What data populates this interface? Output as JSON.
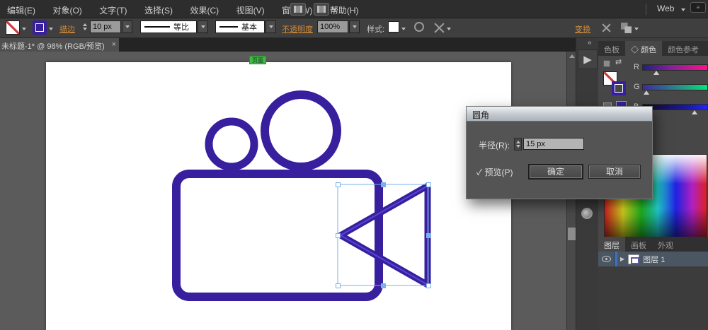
{
  "colors": {
    "artwork_purple": "#371f9e",
    "artwork_highlight": "#5546d8",
    "selection_blue": "#7ab1e8",
    "smart_guide_green": "#44b749",
    "link_orange": "#cf8a3a"
  },
  "icons": {
    "dropdown": "▾",
    "close": "×",
    "collapse": "«",
    "play": "▶",
    "expand": "▶",
    "check": "✓",
    "swap": "⇄",
    "char_panel": "A|",
    "paragraph_panel": "¶",
    "diamond": "◇"
  },
  "menu_bar": {
    "items": [
      "编辑(E)",
      "对象(O)",
      "文字(T)",
      "选择(S)",
      "效果(C)",
      "视图(V)",
      "窗口(W)",
      "帮助(H)"
    ],
    "workspace": "Web"
  },
  "options_bar": {
    "stroke_label": "描边",
    "stroke_width": "10 px",
    "profile_label": "等比",
    "brush_label": "基本",
    "opacity_label": "不透明度",
    "opacity_value": "100%",
    "style_label": "样式:",
    "transform_label": "变换"
  },
  "document_tab": {
    "title": "未标题-1* @ 98% (RGB/预览)"
  },
  "canvas": {
    "smart_guide_label": "页面"
  },
  "dialog": {
    "title": "圆角",
    "radius_label": "半径(R):",
    "radius_value": "15 px",
    "preview_label": "预览(P)",
    "ok_label": "确定",
    "cancel_label": "取消"
  },
  "color_panel": {
    "tabs": [
      "色板",
      "颜色",
      "颜色参考"
    ],
    "channels": [
      "R",
      "G",
      "B"
    ]
  },
  "layers_panel": {
    "tabs": [
      "图层",
      "画板",
      "外观"
    ],
    "layer_name": "图层 1"
  }
}
